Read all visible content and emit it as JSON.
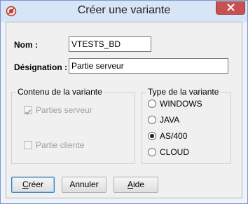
{
  "window": {
    "title": "Créer une variante"
  },
  "form": {
    "nom_label": "Nom :",
    "nom_value": "VTESTS_BD",
    "designation_label": "Désignation :",
    "designation_value": "Partie serveur"
  },
  "contenu": {
    "title": "Contenu de la variante",
    "parties_serveur": {
      "label": "Parties serveur",
      "checked": true,
      "enabled": false
    },
    "partie_cliente": {
      "label": "Partie cliente",
      "checked": false,
      "enabled": false
    }
  },
  "type": {
    "title": "Type de la variante",
    "options": [
      "WINDOWS",
      "JAVA",
      "AS/400",
      "CLOUD"
    ],
    "selected": "AS/400"
  },
  "buttons": {
    "creer_first": "C",
    "creer_rest": "réer",
    "annuler": "Annuler",
    "aide_first": "A",
    "aide_rest": "ide"
  },
  "colors": {
    "titlebar": "#d7e5f6",
    "close": "#c75050",
    "client": "#f0f0f0"
  },
  "icons": {
    "app": "app-logo-icon",
    "close": "close-icon",
    "check": "checkmark-icon"
  }
}
